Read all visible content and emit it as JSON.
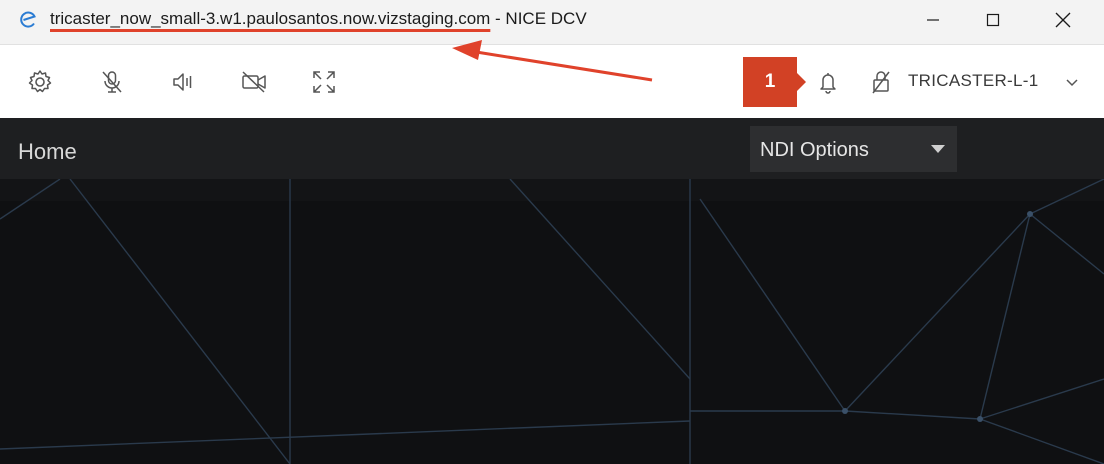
{
  "window": {
    "title_host": "tricaster_now_small-3.w1.paulosantos.now.vizstaging.com",
    "title_suffix": " - NICE DCV",
    "controls": [
      "minimize-icon",
      "maximize-icon",
      "close-icon"
    ]
  },
  "toolbar": {
    "icons": [
      "gear-icon",
      "microphone-off-icon",
      "speaker-icon",
      "camera-off-icon",
      "fullscreen-icon"
    ],
    "notification_badge": "1",
    "user": "TRICASTER-L-1"
  },
  "appbar": {
    "home_label": "Home",
    "ndi_select_value": "NDI Options"
  },
  "colors": {
    "accent": "#d24125",
    "dark_bg": "#0f1012",
    "header_bg": "#1e1f21",
    "line": "#2a3a4c"
  }
}
